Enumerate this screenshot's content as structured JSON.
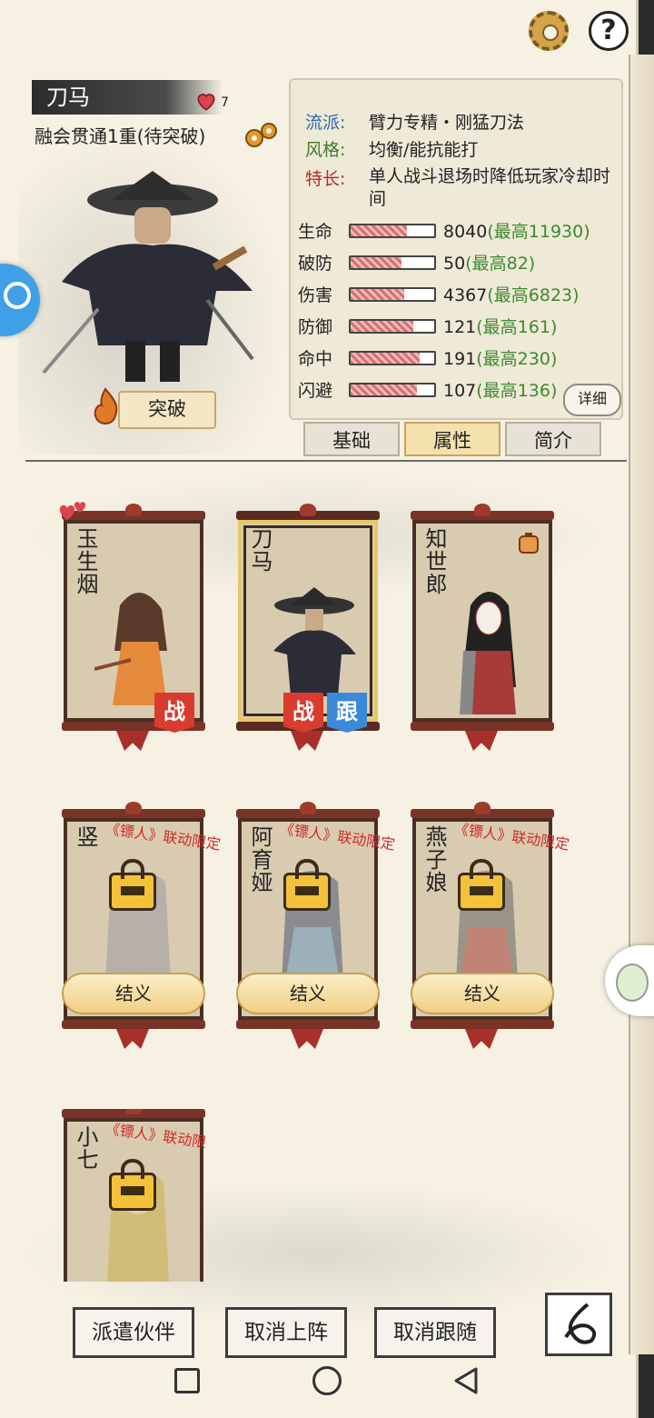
{
  "header": {
    "character_name": "刀马",
    "hearts": "7",
    "realm": "融会贯通1重(待突破)",
    "breakthrough_label": "突破"
  },
  "profile": {
    "school_label": "流派:",
    "school_value": "臂力专精・刚猛刀法",
    "style_label": "风格:",
    "style_value": "均衡/能抗能打",
    "specialty_label": "特长:",
    "specialty_value": "单人战斗退场时降低玩家冷却时间"
  },
  "stats": [
    {
      "label": "生命",
      "value": "8040",
      "max": "(最高11930)",
      "ratio": 0.67
    },
    {
      "label": "破防",
      "value": "50",
      "max": "(最高82)",
      "ratio": 0.61
    },
    {
      "label": "伤害",
      "value": "4367",
      "max": "(最高6823)",
      "ratio": 0.64
    },
    {
      "label": "防御",
      "value": "121",
      "max": "(最高161)",
      "ratio": 0.75
    },
    {
      "label": "命中",
      "value": "191",
      "max": "(最高230)",
      "ratio": 0.83
    },
    {
      "label": "闪避",
      "value": "107",
      "max": "(最高136)",
      "ratio": 0.79
    }
  ],
  "detail_label": "详细",
  "tabs": [
    {
      "label": "基础",
      "active": false
    },
    {
      "label": "属性",
      "active": true
    },
    {
      "label": "简介",
      "active": false
    }
  ],
  "companions": [
    {
      "name": "玉生烟",
      "badges": [
        "战"
      ],
      "locked": false
    },
    {
      "name": "刀马",
      "badges": [
        "战",
        "跟"
      ],
      "locked": false,
      "selected": true
    },
    {
      "name": "知世郎",
      "badges": [],
      "locked": false
    },
    {
      "name": "竖",
      "collab": "《镖人》联动限定",
      "locked": true,
      "action": "结义"
    },
    {
      "name": "阿育娅",
      "collab": "《镖人》联动限定",
      "locked": true,
      "action": "结义"
    },
    {
      "name": "燕子娘",
      "collab": "《镖人》联动限定",
      "locked": true,
      "action": "结义"
    },
    {
      "name": "小七",
      "collab": "《镖人》联动限定",
      "locked": true
    }
  ],
  "bottom": {
    "dispatch": "派遣伙伴",
    "cancel_deploy": "取消上阵",
    "cancel_follow": "取消跟随"
  },
  "colors": {
    "accent": "#d93b2f",
    "follow": "#3b8ad9",
    "scroll": "#7a3327"
  }
}
